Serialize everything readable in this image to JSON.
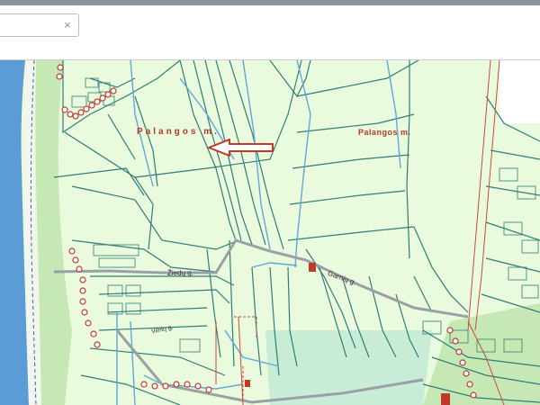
{
  "window": {
    "accent_bar_color": "#8c959e"
  },
  "search": {
    "value": "",
    "placeholder": "",
    "clear_icon": "×"
  },
  "map": {
    "labels": {
      "city_large": "Palangos m.",
      "city_small": "Palangos m."
    },
    "streets": {
      "ziedu": "Žiedų g.",
      "garniu": "Garnių g.",
      "small": "Vilnių g."
    },
    "colors": {
      "sea": "#5b9bd6",
      "land": "#eafadc",
      "forest": "#c6e8b4",
      "parcel_line": "#2f7d7a",
      "water_line": "#5fa7d8",
      "label": "#b5392e",
      "arrow": "#c0392b",
      "road": "#9aa0a6"
    },
    "icons": [
      "arrow-icon",
      "marker-circle-icon",
      "alert-marker-icon"
    ]
  }
}
